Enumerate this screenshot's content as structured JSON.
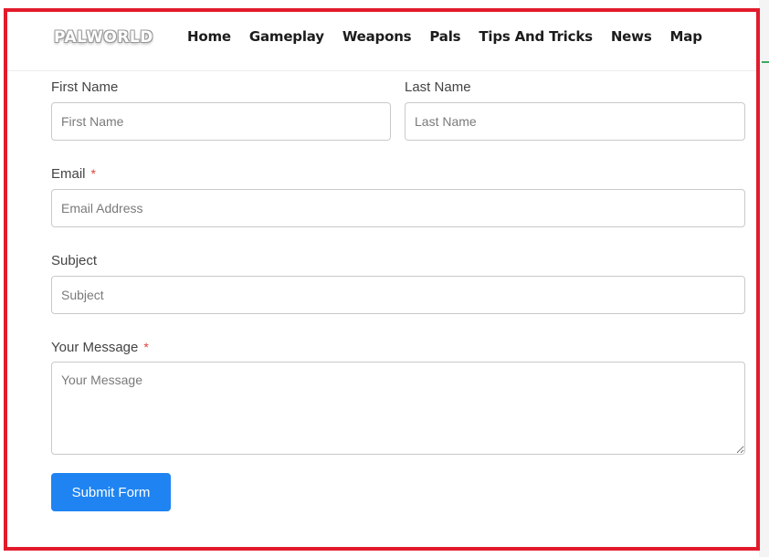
{
  "brand": {
    "logo_text": "PALWORLD"
  },
  "nav": {
    "items": [
      "Home",
      "Gameplay",
      "Weapons",
      "Pals",
      "Tips And Tricks",
      "News",
      "Map"
    ]
  },
  "form": {
    "first_name": {
      "label": "First Name",
      "placeholder": "First Name"
    },
    "last_name": {
      "label": "Last Name",
      "placeholder": "Last Name"
    },
    "email": {
      "label": "Email",
      "required_mark": "*",
      "placeholder": "Email Address"
    },
    "subject": {
      "label": "Subject",
      "placeholder": "Subject"
    },
    "message": {
      "label": "Your Message",
      "required_mark": "*",
      "placeholder": "Your Message"
    },
    "submit_label": "Submit Form"
  },
  "colors": {
    "accent": "#1f84f2",
    "frame": "#e21b2c",
    "required": "#e0453b"
  }
}
